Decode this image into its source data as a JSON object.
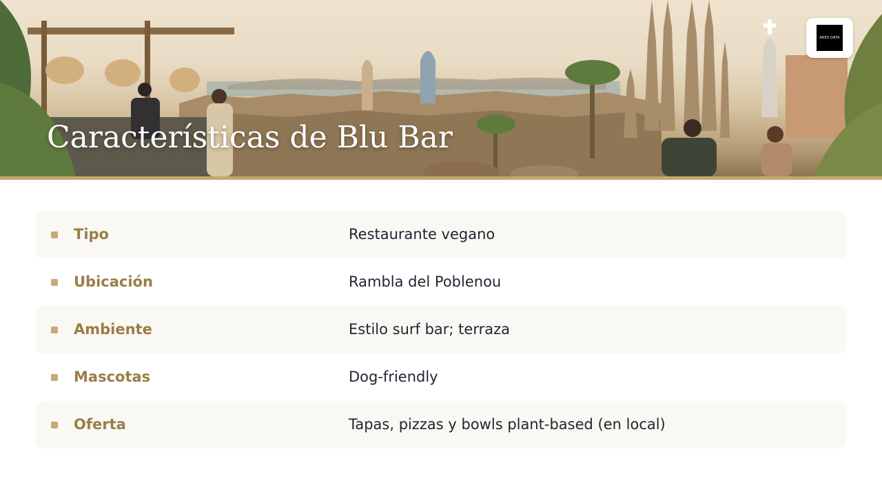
{
  "slide": {
    "title": "Características de Blu Bar",
    "logo_text": "ARES·DATA"
  },
  "colors": {
    "accent_gold": "#c5a868",
    "label_color": "#9a7d48",
    "value_color": "#1f2430",
    "row_shade": "#faf8f3"
  },
  "features": [
    {
      "label": "Tipo",
      "value": "Restaurante vegano"
    },
    {
      "label": "Ubicación",
      "value": "Rambla del Poblenou"
    },
    {
      "label": "Ambiente",
      "value": "Estilo surf bar; terraza"
    },
    {
      "label": "Mascotas",
      "value": "Dog-friendly"
    },
    {
      "label": "Oferta",
      "value": "Tapas, pizzas y bowls plant-based (en local)"
    }
  ]
}
